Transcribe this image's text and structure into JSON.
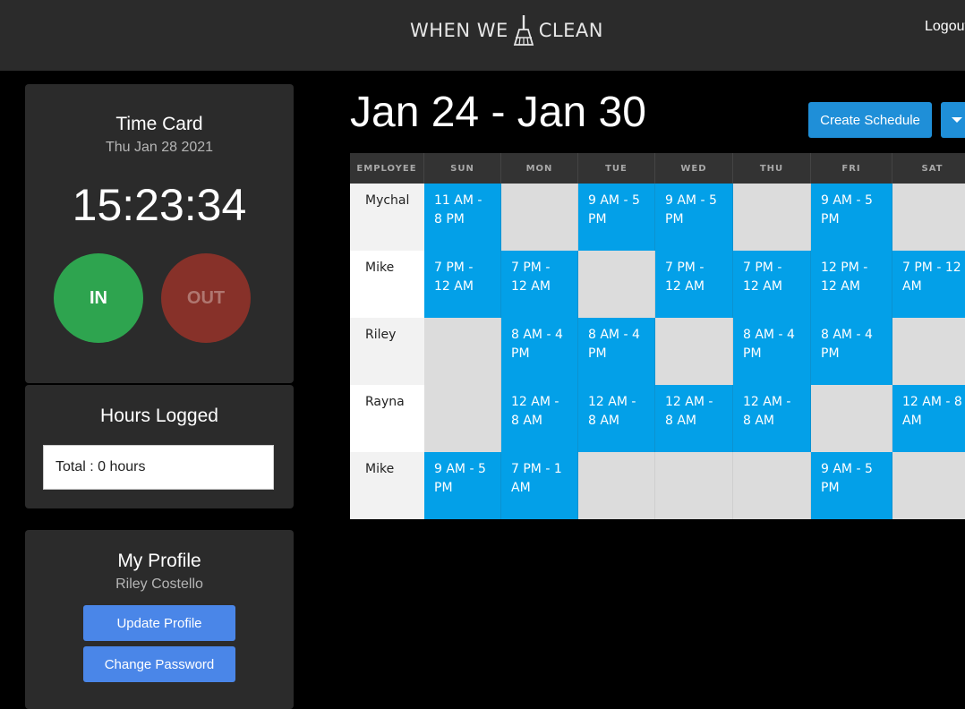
{
  "header": {
    "logo_left": "WHEN WE",
    "logo_right": "CLEAN",
    "logout": "Logout"
  },
  "time_card": {
    "title": "Time Card",
    "date": "Thu Jan 28 2021",
    "clock": "15:23:34",
    "in_label": "IN",
    "out_label": "OUT",
    "colors": {
      "in": "#2ea44f",
      "out": "#873129"
    }
  },
  "hours_logged": {
    "title": "Hours Logged",
    "total": "Total : 0 hours"
  },
  "profile": {
    "title": "My Profile",
    "name": "Riley Costello",
    "update_label": "Update Profile",
    "password_label": "Change Password"
  },
  "schedule": {
    "week_title": "Jan 24 - Jan 30",
    "create_label": "Create Schedule",
    "accent": "#03a0e8",
    "columns": [
      "EMPLOYEE",
      "SUN",
      "MON",
      "TUE",
      "WED",
      "THU",
      "FRI",
      "SAT"
    ],
    "rows": [
      {
        "name": "Mychal",
        "shifts": [
          "11 AM - 8 PM",
          "",
          "9 AM - 5 PM",
          "9 AM - 5 PM",
          "",
          "9 AM - 5 PM",
          ""
        ]
      },
      {
        "name": "Mike",
        "shifts": [
          "7 PM - 12 AM",
          "7 PM - 12 AM",
          "",
          "7 PM - 12 AM",
          "7 PM - 12 AM",
          "12 PM - 12 AM",
          "7 PM - 12 AM"
        ]
      },
      {
        "name": "Riley",
        "shifts": [
          "",
          "8 AM - 4 PM",
          "8 AM - 4 PM",
          "",
          "8 AM - 4 PM",
          "8 AM - 4 PM",
          ""
        ]
      },
      {
        "name": "Rayna",
        "shifts": [
          "",
          "12 AM - 8 AM",
          "12 AM - 8 AM",
          "12 AM - 8 AM",
          "12 AM - 8 AM",
          "",
          "12 AM - 8 AM"
        ]
      },
      {
        "name": "Mike",
        "shifts": [
          "9 AM - 5 PM",
          "7 PM - 1 AM",
          "",
          "",
          "",
          "9 AM - 5 PM",
          ""
        ]
      }
    ]
  }
}
